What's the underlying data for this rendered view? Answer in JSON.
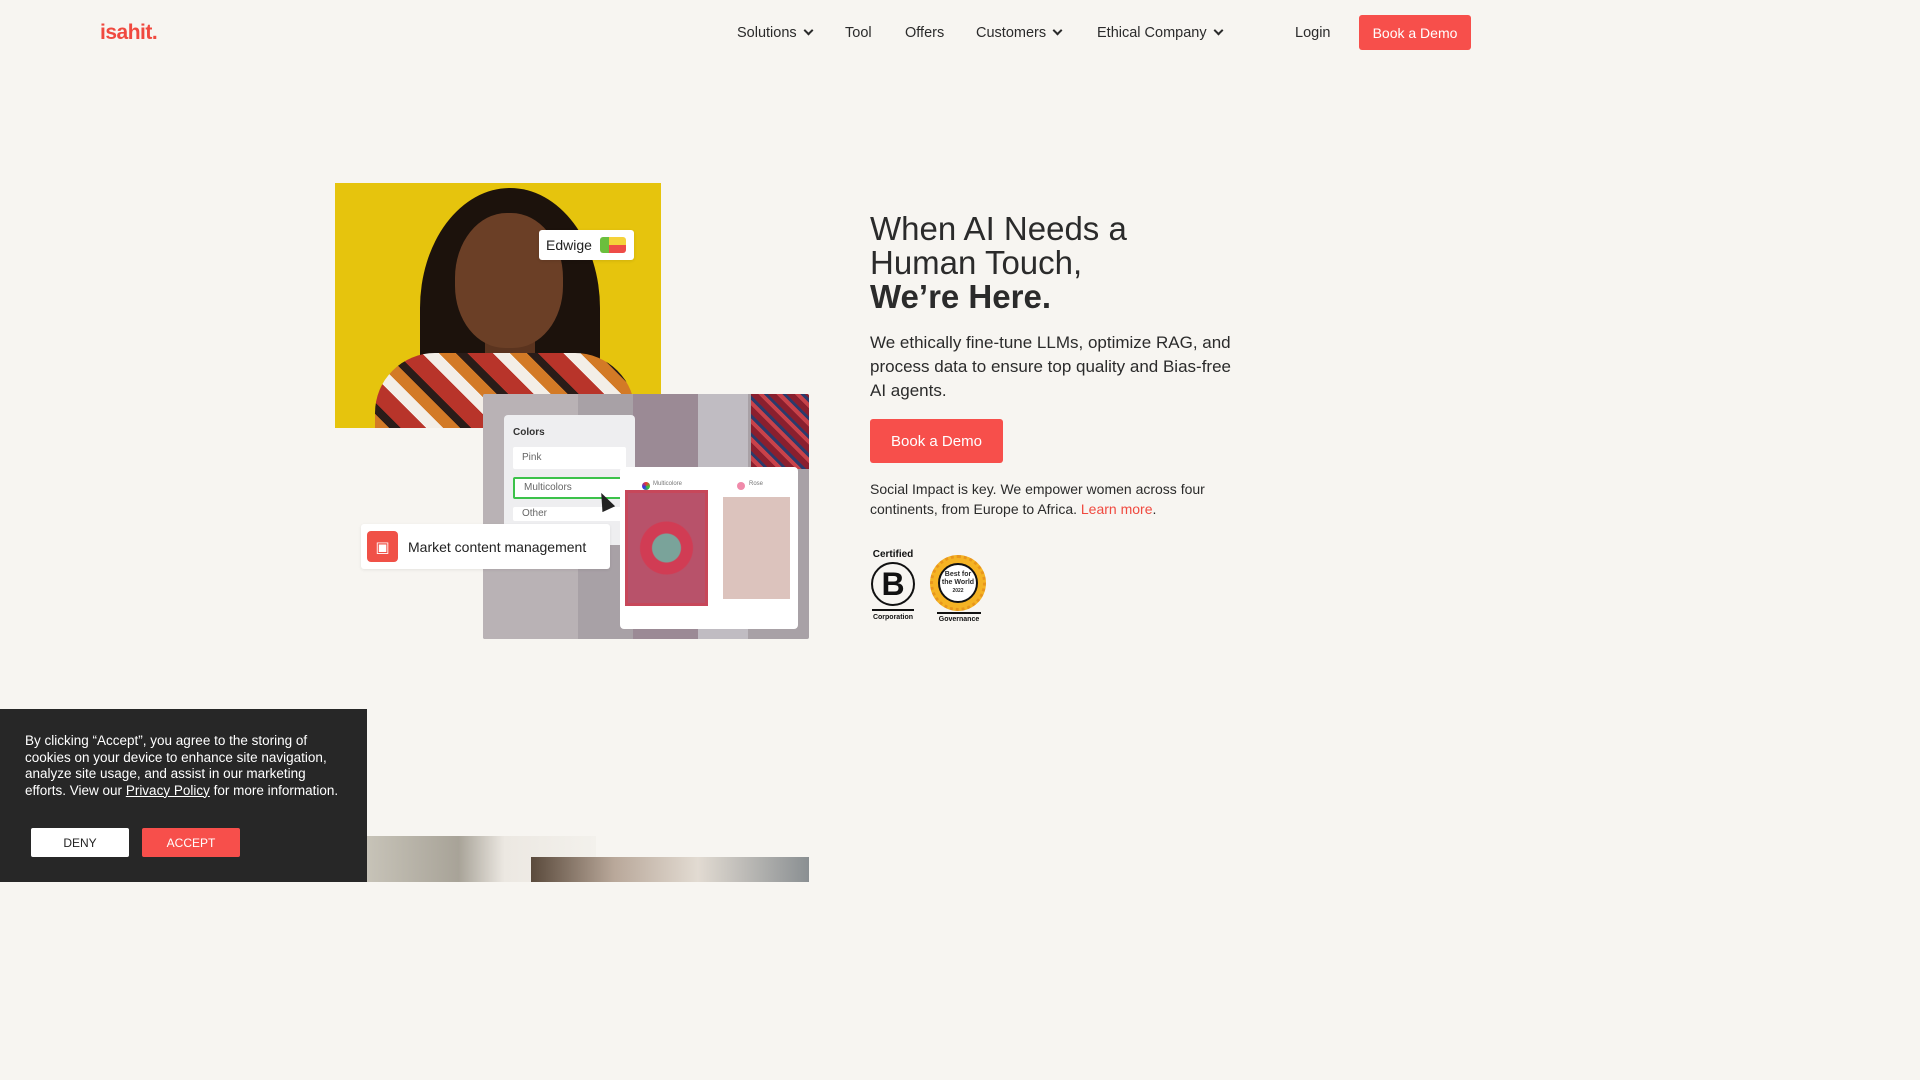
{
  "header": {
    "logo": "isahit.",
    "nav": [
      {
        "label": "Solutions",
        "dropdown": true
      },
      {
        "label": "Tool",
        "dropdown": false
      },
      {
        "label": "Offers",
        "dropdown": false
      },
      {
        "label": "Customers",
        "dropdown": true
      },
      {
        "label": "Ethical Company",
        "dropdown": true
      }
    ],
    "login": "Login",
    "demo_button": "Book a Demo"
  },
  "hero": {
    "title_line1": "When AI Needs a",
    "title_line2": "Human Touch,",
    "title_bold": "We’re Here.",
    "lead": "We ethically fine-tune LLMs, optimize RAG, and process data to ensure top quality and Bias-free AI agents.",
    "cta": "Book a Demo",
    "impact_text": "Social Impact is key. We empower women across four continents, from Europe to Africa.",
    "impact_link": "Learn more",
    "impact_end": "."
  },
  "visual": {
    "name_tag": "Edwige",
    "colors_title": "Colors",
    "color_options": [
      "Pink",
      "Multicolors",
      "Other"
    ],
    "card_labels": [
      "Multicolore",
      "Rose"
    ],
    "task_label": "Market content management"
  },
  "badges": {
    "bcorp_top": "Certified",
    "bcorp_letter": "B",
    "bcorp_bottom": "Corporation",
    "bestworld_text": "Best for the World",
    "bestworld_year": "2022",
    "bestworld_bottom": "Governance"
  },
  "cookie": {
    "text_before": "By clicking “Accept”, you agree to the storing of cookies on your device to enhance site navigation, analyze site usage, and assist in our marketing efforts. View our ",
    "link": "Privacy Policy",
    "text_after": " for more information.",
    "deny": "DENY",
    "accept": "ACCEPT"
  },
  "colors": {
    "accent": "#f74f4b",
    "background": "#f7f5f1",
    "cookie_bg": "#272727",
    "selected_option": "#3cc24a"
  }
}
